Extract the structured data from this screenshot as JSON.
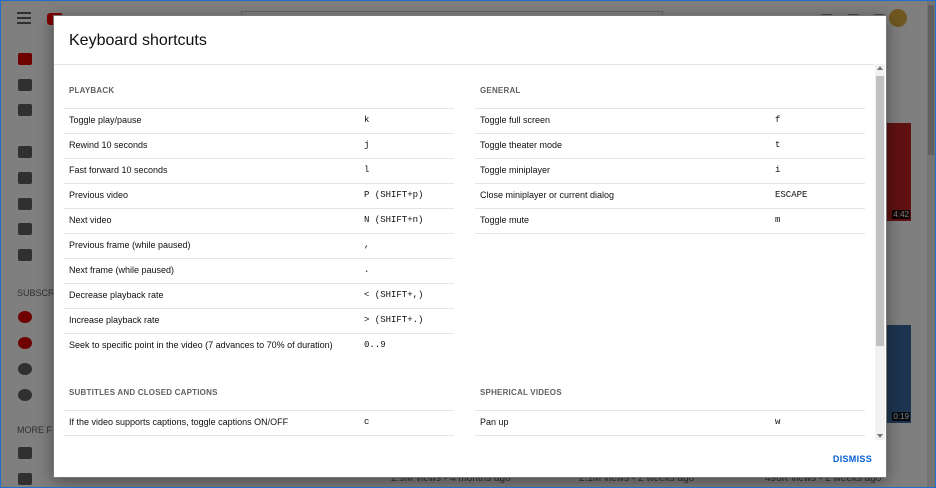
{
  "dialog": {
    "title": "Keyboard shortcuts",
    "dismiss_label": "DISMISS"
  },
  "sections": {
    "playback": {
      "heading": "PLAYBACK",
      "rows": [
        {
          "label": "Toggle play/pause",
          "key": "k"
        },
        {
          "label": "Rewind 10 seconds",
          "key": "j"
        },
        {
          "label": "Fast forward 10 seconds",
          "key": "l"
        },
        {
          "label": "Previous video",
          "key": "P (SHIFT+p)"
        },
        {
          "label": "Next video",
          "key": "N (SHIFT+n)"
        },
        {
          "label": "Previous frame (while paused)",
          "key": ","
        },
        {
          "label": "Next frame (while paused)",
          "key": "."
        },
        {
          "label": "Decrease playback rate",
          "key": "< (SHIFT+,)"
        },
        {
          "label": "Increase playback rate",
          "key": "> (SHIFT+.)"
        },
        {
          "label": "Seek to specific point in the video (7 advances to 70% of duration)",
          "key": "0..9"
        }
      ]
    },
    "general": {
      "heading": "GENERAL",
      "rows": [
        {
          "label": "Toggle full screen",
          "key": "f"
        },
        {
          "label": "Toggle theater mode",
          "key": "t"
        },
        {
          "label": "Toggle miniplayer",
          "key": "i"
        },
        {
          "label": "Close miniplayer or current dialog",
          "key": "ESCAPE"
        },
        {
          "label": "Toggle mute",
          "key": "m"
        }
      ]
    },
    "subtitles": {
      "heading": "SUBTITLES AND CLOSED CAPTIONS",
      "rows": [
        {
          "label": "If the video supports captions, toggle captions ON/OFF",
          "key": "c"
        }
      ]
    },
    "spherical": {
      "heading": "SPHERICAL VIDEOS",
      "rows": [
        {
          "label": "Pan up",
          "key": "w"
        }
      ]
    }
  },
  "background": {
    "thumb_durations": [
      "4:42",
      "0:19"
    ],
    "bottom_texts": [
      "2.9M views • 4 months ago",
      "2.1M views • 2 weeks ago",
      "490K views • 2 weeks ago"
    ],
    "sidebar_labels": [
      "SUBSCR",
      "MORE F"
    ]
  },
  "colors": {
    "accent": "#065fd4",
    "scrim": "rgba(0,0,0,0.5)",
    "window_border": "#1f6fd1"
  }
}
